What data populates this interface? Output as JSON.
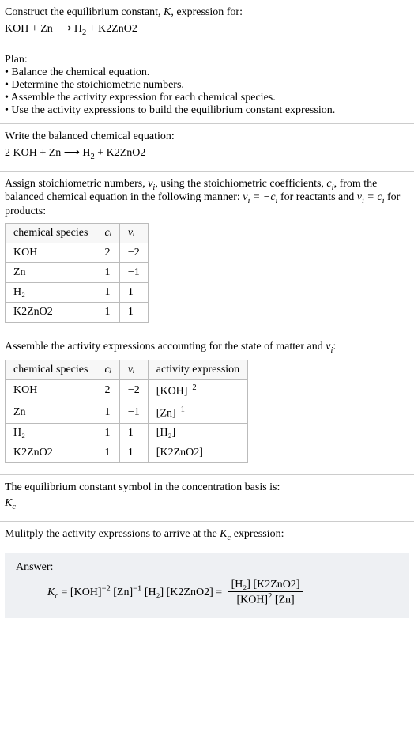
{
  "intro": {
    "line1": "Construct the equilibrium constant, ",
    "K": "K",
    "line1b": ", expression for:",
    "eq": "KOH + Zn ⟶ H",
    "eq_sub": "2",
    "eq_b": " + K2ZnO2"
  },
  "plan": {
    "title": "Plan:",
    "items": [
      "Balance the chemical equation.",
      "Determine the stoichiometric numbers.",
      "Assemble the activity expression for each chemical species.",
      "Use the activity expressions to build the equilibrium constant expression."
    ]
  },
  "balanced": {
    "title": "Write the balanced chemical equation:",
    "eq_a": "2 KOH + Zn ⟶ H",
    "eq_sub": "2",
    "eq_b": " + K2ZnO2"
  },
  "assign": {
    "text_a": "Assign stoichiometric numbers, ",
    "nu": "ν",
    "i": "i",
    "text_b": ", using the stoichiometric coefficients, ",
    "c": "c",
    "text_c": ", from the balanced chemical equation in the following manner: ",
    "eq1_a": "ν",
    "eq1_b": " = −c",
    "text_d": " for reactants and ",
    "eq2_a": "ν",
    "eq2_b": " = c",
    "text_e": " for products:"
  },
  "table1": {
    "headers": [
      "chemical species",
      "cᵢ",
      "νᵢ"
    ],
    "rows": [
      [
        "KOH",
        "2",
        "−2"
      ],
      [
        "Zn",
        "1",
        "−1"
      ],
      [
        "H₂",
        "1",
        "1"
      ],
      [
        "K2ZnO2",
        "1",
        "1"
      ]
    ]
  },
  "assemble": {
    "text_a": "Assemble the activity expressions accounting for the state of matter and ",
    "nu": "ν",
    "i": "i",
    "text_b": ":"
  },
  "table2": {
    "headers": [
      "chemical species",
      "cᵢ",
      "νᵢ",
      "activity expression"
    ],
    "rows": [
      {
        "sp": "KOH",
        "c": "2",
        "v": "−2",
        "act_base": "[KOH]",
        "act_exp": "−2"
      },
      {
        "sp": "Zn",
        "c": "1",
        "v": "−1",
        "act_base": "[Zn]",
        "act_exp": "−1"
      },
      {
        "sp": "H₂",
        "c": "1",
        "v": "1",
        "act_base": "[H₂]",
        "act_exp": ""
      },
      {
        "sp": "K2ZnO2",
        "c": "1",
        "v": "1",
        "act_base": "[K2ZnO2]",
        "act_exp": ""
      }
    ]
  },
  "symbol": {
    "text": "The equilibrium constant symbol in the concentration basis is:",
    "Kc_K": "K",
    "Kc_c": "c"
  },
  "multiply": {
    "text_a": "Mulitply the activity expressions to arrive at the ",
    "Kc_K": "K",
    "Kc_c": "c",
    "text_b": " expression:"
  },
  "answer": {
    "label": "Answer:",
    "lhs_K": "K",
    "lhs_c": "c",
    "eq": " = ",
    "lhs2": "[KOH]",
    "lhs2_exp": "−2",
    "lhs3": " [Zn]",
    "lhs3_exp": "−1",
    "lhs4": " [H₂] [K2ZnO2] = ",
    "num": "[H₂] [K2ZnO2]",
    "den_a": "[KOH]",
    "den_exp": "2",
    "den_b": " [Zn]"
  }
}
